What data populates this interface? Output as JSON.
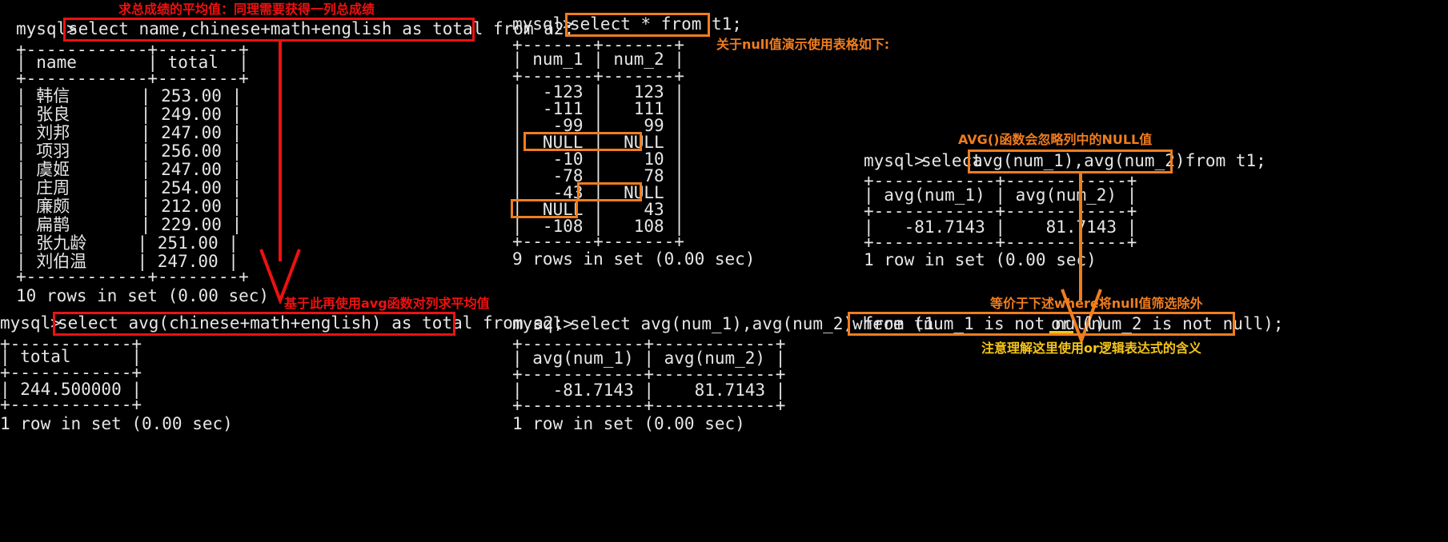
{
  "meta": {
    "title": "MySQL AVG() and NULL demonstration terminal screenshot",
    "colors": {
      "background": "#000000",
      "terminal_text": "#e6e6e6",
      "annotation_red": "#f01010",
      "annotation_orange": "#f07d1e",
      "annotation_yellow": "#f5c518"
    }
  },
  "annotations": {
    "top_left": "求总成绩的平均值：同理需要获得一列总成绩",
    "mid_left": "基于此再使用avg函数对列求平均值",
    "top_middle": "关于null值演示使用表格如下:",
    "right_avg": "AVG()函数会忽略列中的NULL值",
    "right_where": "等价于下述where将null值筛选除外",
    "bottom_or": "注意理解这里使用or逻辑表达式的含义"
  },
  "blocks": {
    "left_top": {
      "prompt": "mysql>",
      "command": "select name,chinese+math+english as total from a2;",
      "table": {
        "rule": "+------------+--------+",
        "header": "| name       | total  |",
        "rows": [
          "| 韩信       | 253.00 |",
          "| 张良       | 249.00 |",
          "| 刘邦       | 247.00 |",
          "| 项羽       | 256.00 |",
          "| 虞姬       | 247.00 |",
          "| 庄周       | 254.00 |",
          "| 廉颇       | 212.00 |",
          "| 扁鹊       | 229.00 |",
          "| 张九龄     | 251.00 |",
          "| 刘伯温     | 247.00 |"
        ]
      },
      "status": "10 rows in set (0.00 sec)"
    },
    "left_bottom": {
      "prompt": "mysql>",
      "command": "select avg(chinese+math+english) as total from a2;",
      "table": {
        "rule": "+------------+",
        "header": "| total      |",
        "rows": [
          "| 244.500000 |"
        ]
      },
      "status": "1 row in set (0.00 sec)"
    },
    "middle_top": {
      "prompt": "mysql>",
      "command": "select * from t1;",
      "table": {
        "rule": "+-------+-------+",
        "header": "| num_1 | num_2 |",
        "rows": [
          "|  -123 |   123 |",
          "|  -111 |   111 |",
          "|   -99 |    99 |",
          "|  NULL |  NULL |",
          "|   -10 |    10 |",
          "|   -78 |    78 |",
          "|   -43 |  NULL |",
          "|  NULL |    43 |",
          "|  -108 |   108 |"
        ]
      },
      "status": "9 rows in set (0.00 sec)"
    },
    "middle_bottom": {
      "prompt": "mysql>",
      "command_prefix": "select avg(num_1),avg(num_2) from t1 ",
      "command_where_a": "where (num_1 is not null) ",
      "command_or": "or",
      "command_where_b": " (num_2 is not null);",
      "table": {
        "rule": "+------------+------------+",
        "header": "| avg(num_1) | avg(num_2) |",
        "rows": [
          "|   -81.7143 |    81.7143 |"
        ]
      },
      "status": "1 row in set (0.00 sec)"
    },
    "right_top": {
      "prompt": "mysql>",
      "command_prefix": "select ",
      "command_highlight": "avg(num_1),avg(num_2)",
      "command_suffix": " from t1;",
      "table": {
        "rule": "+------------+------------+",
        "header": "| avg(num_1) | avg(num_2) |",
        "rows": [
          "|   -81.7143 |    81.7143 |"
        ]
      },
      "status": "1 row in set (0.00 sec)"
    }
  },
  "table_data": {
    "a2_totals": {
      "type": "table",
      "columns": [
        "name",
        "total"
      ],
      "rows": [
        [
          "韩信",
          "253.00"
        ],
        [
          "张良",
          "249.00"
        ],
        [
          "刘邦",
          "247.00"
        ],
        [
          "项羽",
          "256.00"
        ],
        [
          "虞姬",
          "247.00"
        ],
        [
          "庄周",
          "254.00"
        ],
        [
          "廉颇",
          "212.00"
        ],
        [
          "扁鹊",
          "229.00"
        ],
        [
          "张九龄",
          "251.00"
        ],
        [
          "刘伯温",
          "247.00"
        ]
      ],
      "row_count": 10,
      "average_total": "244.500000"
    },
    "t1": {
      "type": "table",
      "columns": [
        "num_1",
        "num_2"
      ],
      "rows": [
        [
          "-123",
          "123"
        ],
        [
          "-111",
          "111"
        ],
        [
          "-99",
          "99"
        ],
        [
          "NULL",
          "NULL"
        ],
        [
          "-10",
          "10"
        ],
        [
          "-78",
          "78"
        ],
        [
          "-43",
          "NULL"
        ],
        [
          "NULL",
          "43"
        ],
        [
          "-108",
          "108"
        ]
      ],
      "row_count": 9,
      "avg_num_1": "-81.7143",
      "avg_num_2": "81.7143"
    }
  }
}
